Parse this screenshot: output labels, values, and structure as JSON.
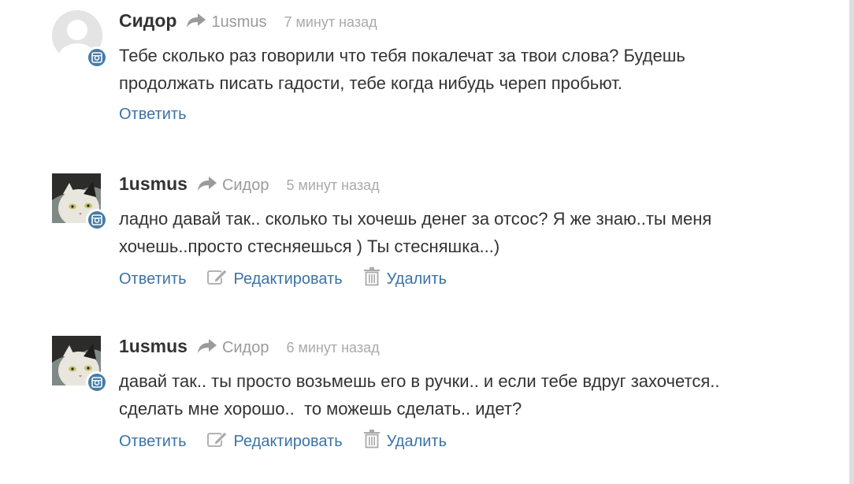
{
  "comments": [
    {
      "author": "Сидор",
      "reply_to": "1usmus",
      "time": "7 минут назад",
      "text": "Тебе сколько раз говорили что тебя покалечат за твои слова? Будешь\nпродолжать писать гадости, тебе когда нибудь череп пробьют.",
      "actions": {
        "reply": "Ответить"
      }
    },
    {
      "author": "1usmus",
      "reply_to": "Сидор",
      "time": "5 минут назад",
      "text": "ладно давай так.. сколько ты хочешь денег за отсос? Я же знаю..ты меня\nхочешь..просто стесняешься ) Ты стесняшка...)",
      "actions": {
        "reply": "Ответить",
        "edit": "Редактировать",
        "delete": "Удалить"
      }
    },
    {
      "author": "1usmus",
      "reply_to": "Сидор",
      "time": "6 минут назад",
      "text": "давай так.. ты просто возьмешь его в ручки.. и если тебе вдруг захочется..\nсделать мне хорошо..  то можешь сделать.. идет?",
      "actions": {
        "reply": "Ответить",
        "edit": "Редактировать",
        "delete": "Удалить"
      }
    }
  ],
  "colors": {
    "link": "#3b73a6",
    "badge": "#477ca5",
    "muted": "#9a9a9a",
    "text": "#333333"
  },
  "icons": {
    "reply_arrow": "share-arrow-icon",
    "badge": "instagram-icon",
    "edit": "pencil-square-icon",
    "delete": "trash-icon"
  }
}
